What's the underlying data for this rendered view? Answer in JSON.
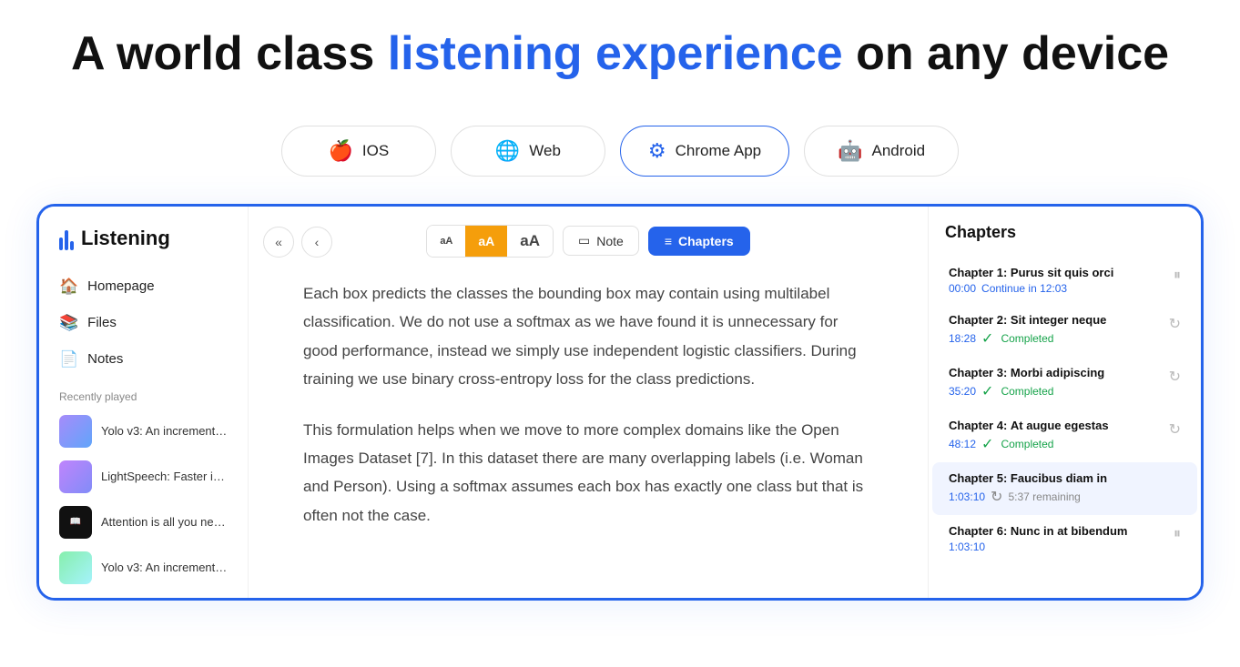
{
  "hero": {
    "title_part1": "A world class ",
    "title_highlight": "listening experience",
    "title_part2": " on any device"
  },
  "platforms": [
    {
      "id": "ios",
      "label": "IOS",
      "icon": "🍎",
      "active": false
    },
    {
      "id": "web",
      "label": "Web",
      "icon": "🌐",
      "active": false
    },
    {
      "id": "chrome",
      "label": "Chrome App",
      "icon": "🔵",
      "active": true
    },
    {
      "id": "android",
      "label": "Android",
      "icon": "🤖",
      "active": false
    }
  ],
  "sidebar": {
    "logo_text": "Listening",
    "nav_items": [
      {
        "id": "homepage",
        "label": "Homepage",
        "icon": "🏠"
      },
      {
        "id": "files",
        "label": "Files",
        "icon": "📚"
      },
      {
        "id": "notes",
        "label": "Notes",
        "icon": "📄"
      }
    ],
    "recently_played_label": "Recently played",
    "recent_items": [
      {
        "id": 1,
        "title": "Yolo v3: An incremental...",
        "thumb": "1"
      },
      {
        "id": 2,
        "title": "LightSpeech: Faster inf...",
        "thumb": "2"
      },
      {
        "id": 3,
        "title": "Attention is all you need...",
        "thumb": "3"
      },
      {
        "id": 4,
        "title": "Yolo v3: An incremental...",
        "thumb": "4"
      }
    ]
  },
  "toolbar": {
    "font_small": "aA",
    "font_medium": "aA",
    "font_large": "aA",
    "note_label": "Note",
    "chapters_label": "Chapters"
  },
  "reading": {
    "paragraphs": [
      "Each box predicts the classes the bounding box may contain using multilabel classification. We do not use a softmax as we have found it is unnecessary for good performance, instead we simply use independent logistic classifiers. During training we use binary cross-entropy loss for the class predictions.",
      "This formulation helps when we move to more complex domains like the Open Images Dataset [7]. In this dataset there are many overlapping labels (i.e. Woman and Person). Using a softmax assumes each box has exactly one class but that is often not the case."
    ]
  },
  "chapters": {
    "title": "Chapters",
    "items": [
      {
        "id": 1,
        "name": "Chapter 1:",
        "subtitle": "Purus sit quis orci",
        "time": "00:00",
        "status": "continue",
        "status_text": "Continue in 12:03"
      },
      {
        "id": 2,
        "name": "Chapter 2:",
        "subtitle": "Sit integer neque",
        "time": "18:28",
        "status": "completed",
        "status_text": "Completed"
      },
      {
        "id": 3,
        "name": "Chapter 3:",
        "subtitle": "Morbi adipiscing",
        "time": "35:20",
        "status": "completed",
        "status_text": "Completed"
      },
      {
        "id": 4,
        "name": "Chapter 4:",
        "subtitle": "At augue egestas",
        "time": "48:12",
        "status": "completed",
        "status_text": "Completed"
      },
      {
        "id": 5,
        "name": "Chapter 5:",
        "subtitle": "Faucibus diam in",
        "time": "1:03:10",
        "status": "remaining",
        "status_text": "5:37 remaining",
        "active": true
      },
      {
        "id": 6,
        "name": "Chapter 6:",
        "subtitle": "Nunc in at bibendum",
        "time": "1:03:10",
        "status": "none",
        "status_text": ""
      }
    ]
  }
}
